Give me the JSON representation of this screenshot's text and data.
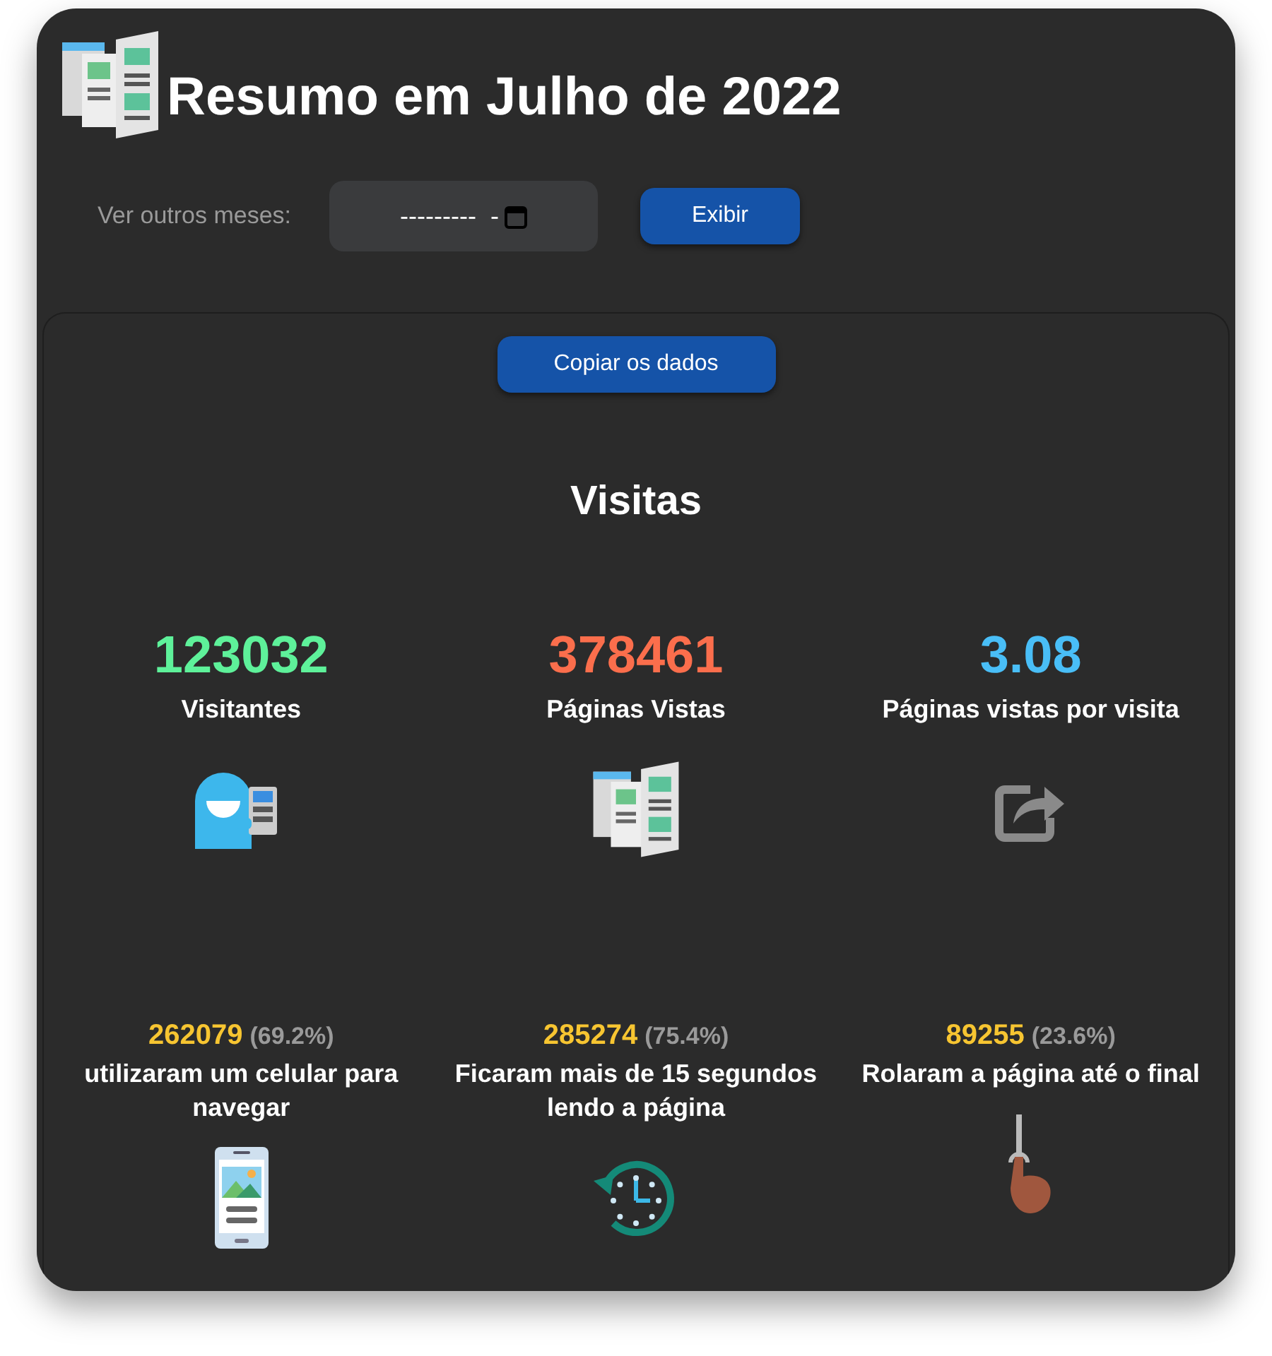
{
  "title": "Resumo em Julho de 2022",
  "month_picker": {
    "label": "Ver outros meses:",
    "value": "---------  -"
  },
  "show_button": "Exibir",
  "copy_button": "Copiar os dados",
  "section_title": "Visitas",
  "main_stats": [
    {
      "value": "123032",
      "label": "Visitantes",
      "color": "#5ef19a",
      "kind": "visitor"
    },
    {
      "value": "378461",
      "label": "Páginas Vistas",
      "color": "#fb6e4c",
      "kind": "pages"
    },
    {
      "value": "3.08",
      "label": "Páginas vistas por visita",
      "color": "#49bef7",
      "kind": "share"
    }
  ],
  "detail_stats": [
    {
      "value": "262079",
      "percent": "(69.2%)",
      "label": "utilizaram um celular para navegar",
      "kind": "phone"
    },
    {
      "value": "285274",
      "percent": "(75.4%)",
      "label": "Ficaram mais de 15 segundos lendo a página",
      "kind": "clock"
    },
    {
      "value": "89255",
      "percent": "(23.6%)",
      "label": "Rolaram a página até o final",
      "kind": "scroll"
    }
  ]
}
